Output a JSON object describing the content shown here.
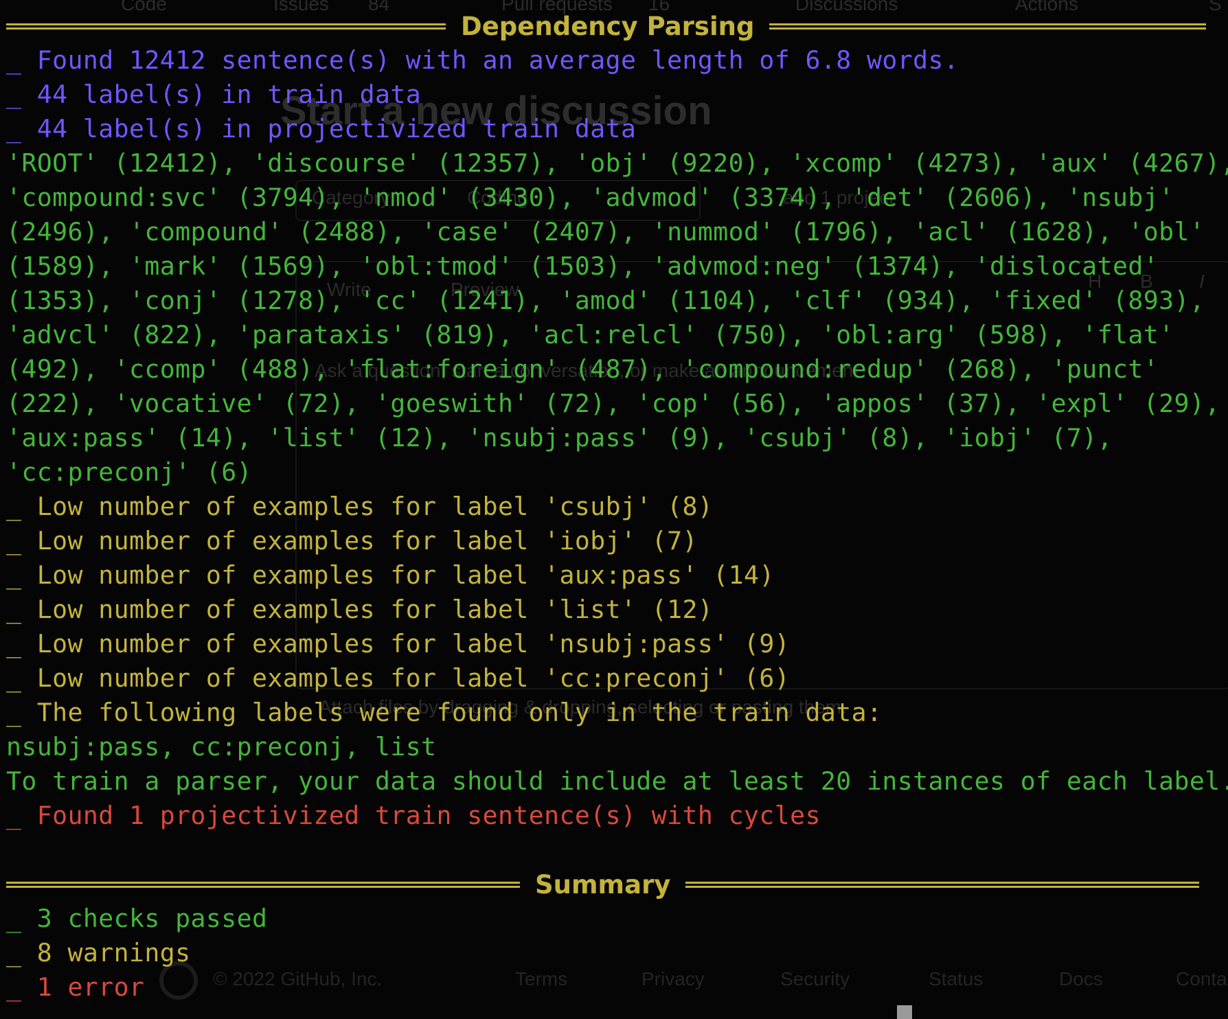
{
  "terminal": {
    "dependency_header": "Dependency Parsing",
    "lines": [
      {
        "type": "info",
        "text": "_ Found 12412 sentence(s) with an average length of 6.8 words."
      },
      {
        "type": "info",
        "text": "_ 44 label(s) in train data"
      },
      {
        "type": "info",
        "text": "_ 44 label(s) in projectivized train data"
      },
      {
        "type": "good",
        "text": "'ROOT' (12412), 'discourse' (12357), 'obj' (9220), 'xcomp' (4273), 'aux' (4267),"
      },
      {
        "type": "good",
        "text": "'compound:svc' (3794), 'nmod' (3430), 'advmod' (3374), 'det' (2606), 'nsubj'"
      },
      {
        "type": "good",
        "text": "(2496), 'compound' (2488), 'case' (2407), 'nummod' (1796), 'acl' (1628), 'obl'"
      },
      {
        "type": "good",
        "text": "(1589), 'mark' (1569), 'obl:tmod' (1503), 'advmod:neg' (1374), 'dislocated'"
      },
      {
        "type": "good",
        "text": "(1353), 'conj' (1278), 'cc' (1241), 'amod' (1104), 'clf' (934), 'fixed' (893),"
      },
      {
        "type": "good",
        "text": "'advcl' (822), 'parataxis' (819), 'acl:relcl' (750), 'obl:arg' (598), 'flat'"
      },
      {
        "type": "good",
        "text": "(492), 'ccomp' (488), 'flat:foreign' (487), 'compound:redup' (268), 'punct'"
      },
      {
        "type": "good",
        "text": "(222), 'vocative' (72), 'goeswith' (72), 'cop' (56), 'appos' (37), 'expl' (29),"
      },
      {
        "type": "good",
        "text": "'aux:pass' (14), 'list' (12), 'nsubj:pass' (9), 'csubj' (8), 'iobj' (7),"
      },
      {
        "type": "good",
        "text": "'cc:preconj' (6)"
      },
      {
        "type": "warn",
        "text": "_ Low number of examples for label 'csubj' (8)"
      },
      {
        "type": "warn",
        "text": "_ Low number of examples for label 'iobj' (7)"
      },
      {
        "type": "warn",
        "text": "_ Low number of examples for label 'aux:pass' (14)"
      },
      {
        "type": "warn",
        "text": "_ Low number of examples for label 'list' (12)"
      },
      {
        "type": "warn",
        "text": "_ Low number of examples for label 'nsubj:pass' (9)"
      },
      {
        "type": "warn",
        "text": "_ Low number of examples for label 'cc:preconj' (6)"
      },
      {
        "type": "warn",
        "text": "_ The following labels were found only in the train data:"
      },
      {
        "type": "good",
        "text": "nsubj:pass, cc:preconj, list"
      },
      {
        "type": "good",
        "text": "To train a parser, your data should include at least 20 instances of each label."
      },
      {
        "type": "fail",
        "text": "_ Found 1 projectivized train sentence(s) with cycles"
      }
    ],
    "summary_header": "Summary",
    "summary": [
      {
        "type": "good",
        "text": "_ 3 checks passed"
      },
      {
        "type": "warn",
        "text": "_ 8 warnings"
      },
      {
        "type": "fail",
        "text": "_ 1 error"
      }
    ]
  },
  "background_page": {
    "tabs": [
      "Code",
      "Issues",
      "84",
      "Pull requests",
      "16",
      "Discussions",
      "Actions",
      "S"
    ],
    "title": "Start a new discussion",
    "category_label": "Category:",
    "category_value": "Coding",
    "project_text": "and 1 project",
    "write_tab": "Write",
    "preview_tab": "Preview",
    "toolbar": [
      "H",
      "B",
      "I"
    ],
    "body_placeholder": "Ask a question, start a conversation, or make an announcement",
    "attach_hint": "Attach files by dragging & dropping, selecting or pasting them.",
    "footer": [
      "© 2022 GitHub, Inc.",
      "Terms",
      "Privacy",
      "Security",
      "Status",
      "Docs",
      "Conta"
    ]
  },
  "colors": {
    "background": "#050505",
    "info": "#6f57ff",
    "good": "#43b63a",
    "warn": "#c3b33c",
    "fail": "#d9493c"
  }
}
